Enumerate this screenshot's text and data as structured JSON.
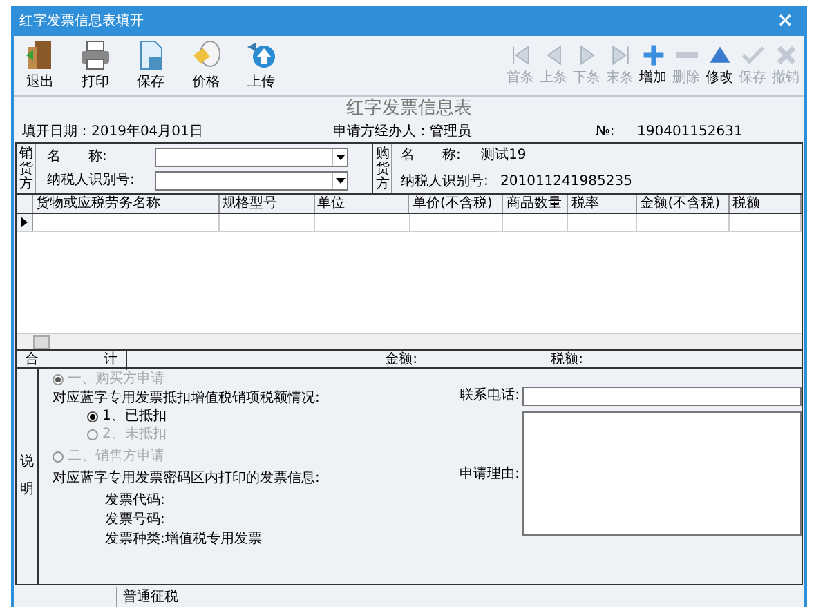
{
  "window": {
    "title": "红字发票信息表填开",
    "close": "×"
  },
  "toolbar": {
    "left": [
      {
        "label": "退出",
        "kind": "exit"
      },
      {
        "label": "打印",
        "kind": "print"
      },
      {
        "label": "保存",
        "kind": "save"
      },
      {
        "label": "价格",
        "kind": "price"
      },
      {
        "label": "上传",
        "kind": "upload"
      }
    ],
    "right": [
      {
        "label": "首条",
        "kind": "first",
        "disabled": true
      },
      {
        "label": "上条",
        "kind": "prev",
        "disabled": true
      },
      {
        "label": "下条",
        "kind": "next",
        "disabled": true
      },
      {
        "label": "末条",
        "kind": "last",
        "disabled": true
      },
      {
        "label": "增加",
        "kind": "add",
        "disabled": false
      },
      {
        "label": "删除",
        "kind": "remove",
        "disabled": true
      },
      {
        "label": "修改",
        "kind": "edit",
        "disabled": false
      },
      {
        "label": "保存",
        "kind": "check",
        "disabled": true
      },
      {
        "label": "撤销",
        "kind": "cancel",
        "disabled": true
      }
    ]
  },
  "heading": "红字发票信息表",
  "info": {
    "date": "填开日期：2019年04月01日",
    "handler": "申请方经办人：管理员",
    "number_label": "№:",
    "number": "190401152631"
  },
  "seller": {
    "label": "销货方",
    "name_label": "名　　称:",
    "taxid_label": "纳税人识别号:"
  },
  "buyer": {
    "label": "购货方",
    "name_label": "名　　称:",
    "name": "测试19",
    "taxid_label": "纳税人识别号:",
    "taxid": "201011241985235"
  },
  "table": {
    "columns": [
      "货物或应税劳务名称",
      "规格型号",
      "单位",
      "单价(不含税)",
      "商品数量",
      "税率",
      "金额(不含税)",
      "税额"
    ]
  },
  "totals": {
    "he": "合",
    "ji": "计",
    "amount_label": "金额:",
    "tax_label": "税额:"
  },
  "notes": {
    "label": "说明",
    "options": [
      {
        "label": "一、购买方申请",
        "selected": true,
        "disabled": true
      },
      {
        "label": "二、销售方申请",
        "selected": false,
        "disabled": true
      }
    ],
    "deduct_title": "对应蓝字专用发票抵扣增值税销项税额情况:",
    "deduct_options": [
      {
        "label": "1、已抵扣",
        "selected": true,
        "disabled": false
      },
      {
        "label": "2、未抵扣",
        "selected": false,
        "disabled": true
      }
    ],
    "invoice_title": "对应蓝字专用发票密码区内打印的发票信息:",
    "code_label": "发票代码:",
    "number_label": "发票号码:",
    "type_label": "发票种类:增值税专用发票",
    "phone_label": "联系电话:",
    "reason_label": "申请理由:"
  },
  "status_bar": "普通征税"
}
